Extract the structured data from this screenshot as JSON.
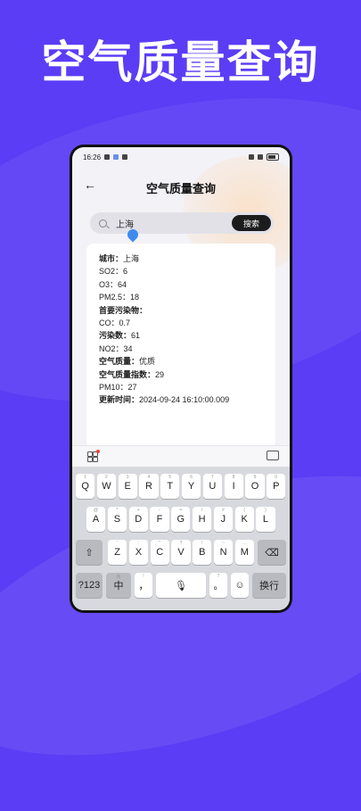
{
  "hero_title": "空气质量查询",
  "status_bar": {
    "time": "16:26",
    "battery": "■"
  },
  "app": {
    "back_icon": "←",
    "title": "空气质量查询"
  },
  "search": {
    "value": "上海",
    "button_label": "搜索"
  },
  "result": [
    {
      "label": "城市：",
      "value": "上海",
      "bold": true
    },
    {
      "label": "SO2：",
      "value": "6",
      "bold": false
    },
    {
      "label": "O3：",
      "value": "64",
      "bold": false
    },
    {
      "label": "PM2.5：",
      "value": "18",
      "bold": false
    },
    {
      "label": "首要污染物：",
      "value": "",
      "bold": true
    },
    {
      "label": "CO：",
      "value": "0.7",
      "bold": false
    },
    {
      "label": "污染数：",
      "value": "61",
      "bold": true
    },
    {
      "label": "NO2：",
      "value": "34",
      "bold": false
    },
    {
      "label": "空气质量：",
      "value": "优质",
      "bold": true
    },
    {
      "label": "空气质量指数：",
      "value": "29",
      "bold": true
    },
    {
      "label": "PM10：",
      "value": "27",
      "bold": false
    },
    {
      "label": "更新时间：",
      "value": "2024-09-24 16:10:00.009",
      "bold": true
    }
  ],
  "keyboard": {
    "row1": [
      {
        "k": "Q",
        "s": "1"
      },
      {
        "k": "W",
        "s": "2"
      },
      {
        "k": "E",
        "s": "3"
      },
      {
        "k": "R",
        "s": "4"
      },
      {
        "k": "T",
        "s": "5"
      },
      {
        "k": "Y",
        "s": "6"
      },
      {
        "k": "U",
        "s": "7"
      },
      {
        "k": "I",
        "s": "8"
      },
      {
        "k": "O",
        "s": "9"
      },
      {
        "k": "P",
        "s": "0"
      }
    ],
    "row2": [
      {
        "k": "A",
        "s": "@"
      },
      {
        "k": "S",
        "s": "*"
      },
      {
        "k": "D",
        "s": "+"
      },
      {
        "k": "F",
        "s": "-"
      },
      {
        "k": "G",
        "s": "="
      },
      {
        "k": "H",
        "s": "/"
      },
      {
        "k": "J",
        "s": "#"
      },
      {
        "k": "K",
        "s": "("
      },
      {
        "k": "L",
        "s": ")"
      }
    ],
    "row3": [
      {
        "k": "Z",
        "s": "'"
      },
      {
        "k": "X",
        "s": ":"
      },
      {
        "k": "C",
        "s": "\""
      },
      {
        "k": "V",
        "s": "?"
      },
      {
        "k": "B",
        "s": "!"
      },
      {
        "k": "N",
        "s": "~"
      },
      {
        "k": "M",
        "s": "…"
      }
    ],
    "shift_icon": "⇧",
    "delete_icon": "⌫",
    "num_label": "?123",
    "lang_label": "中",
    "lang_sub": "英",
    "comma_label": "，",
    "comma_sub": "!",
    "mic_icon": "🎙",
    "period_label": "。",
    "period_sub": "?",
    "emoji_icon": "☺",
    "enter_label": "换行"
  }
}
